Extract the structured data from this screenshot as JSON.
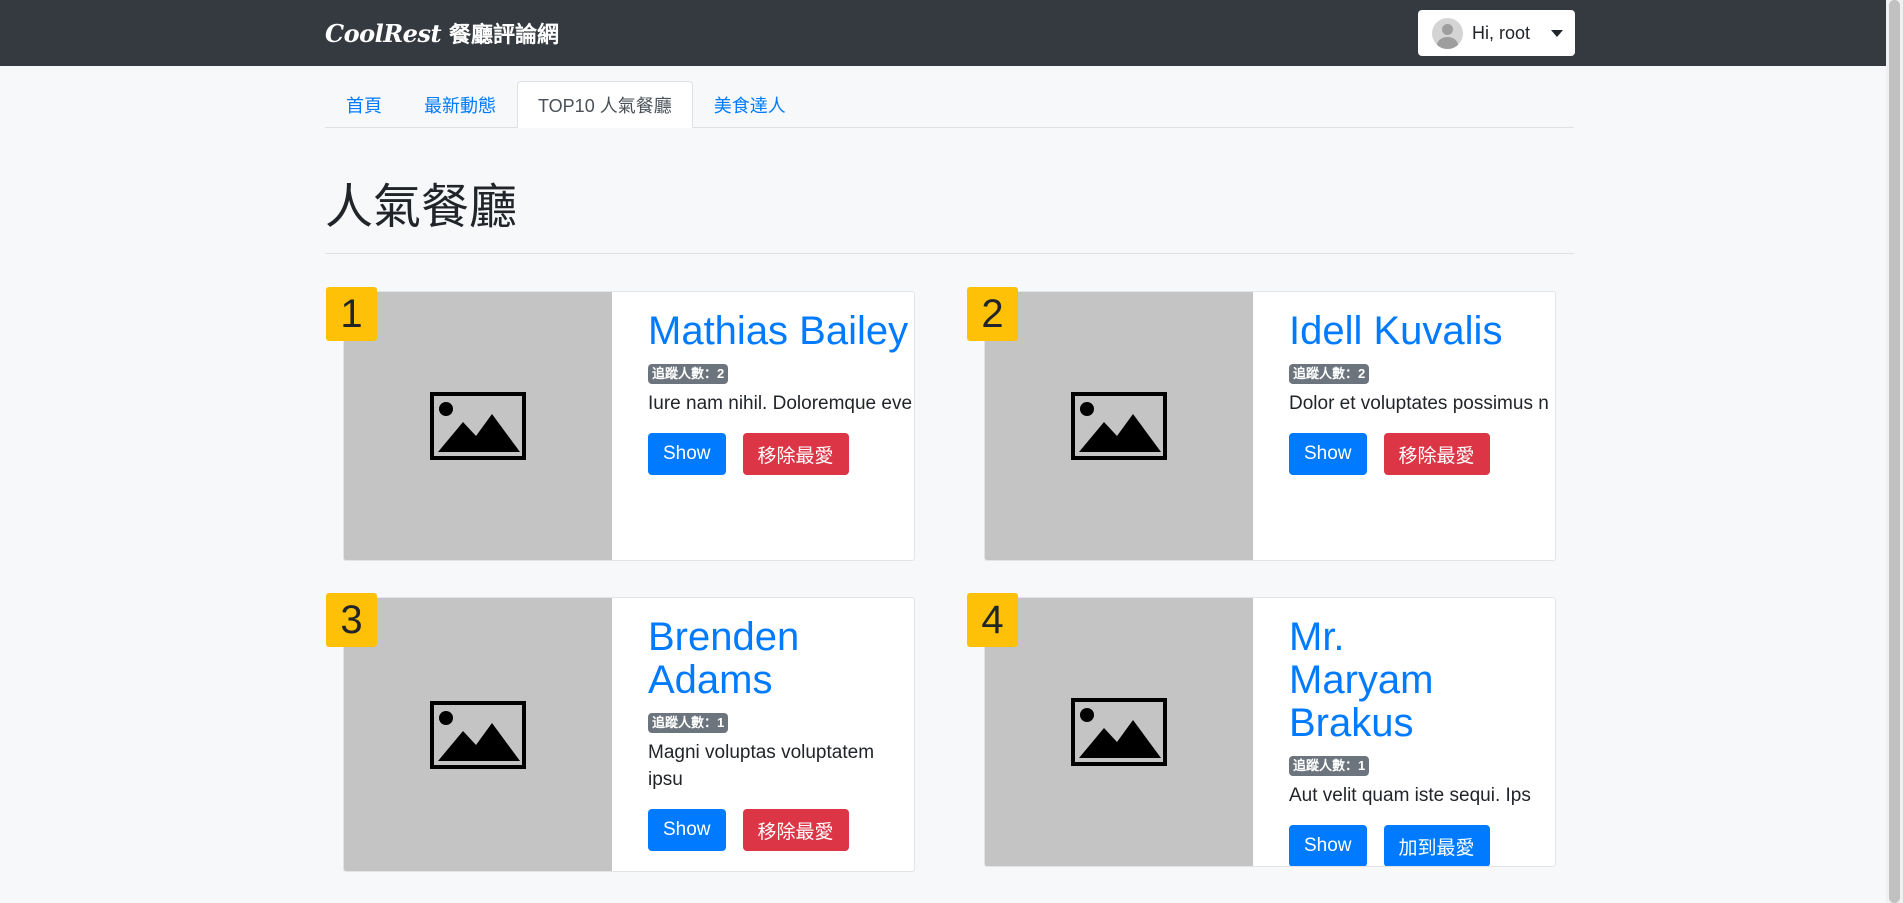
{
  "navbar": {
    "brand_logo": "CoolRest",
    "brand_name": "餐廳評論網",
    "user_label": "Hi, root"
  },
  "tabs": [
    {
      "label": "首頁",
      "active": false
    },
    {
      "label": "最新動態",
      "active": false
    },
    {
      "label": "TOP10 人氣餐廳",
      "active": true
    },
    {
      "label": "美食達人",
      "active": false
    }
  ],
  "page": {
    "title": "人氣餐廳"
  },
  "restaurants": [
    {
      "rank": "1",
      "name": "Mathias Bailey",
      "badge": "追蹤人數：2",
      "description": "Iure nam nihil. Doloremque eve",
      "show_label": "Show",
      "fav_label": "移除最愛",
      "favorited": true
    },
    {
      "rank": "2",
      "name": "Idell Kuvalis",
      "badge": "追蹤人數：2",
      "description": "Dolor et voluptates possimus n",
      "show_label": "Show",
      "fav_label": "移除最愛",
      "favorited": true
    },
    {
      "rank": "3",
      "name": "Brenden Adams",
      "badge": "追蹤人數：1",
      "description": "Magni voluptas voluptatem ipsu",
      "show_label": "Show",
      "fav_label": "移除最愛",
      "favorited": true
    },
    {
      "rank": "4",
      "name": "Mr. Maryam Brakus",
      "badge": "追蹤人數：1",
      "description": "Aut velit quam iste sequi. Ips",
      "show_label": "Show",
      "fav_label": "加到最愛",
      "favorited": false
    }
  ],
  "colors": {
    "navbar_bg": "#343a40",
    "link": "#007bff",
    "danger": "#dc3545",
    "rank_badge": "#ffc107",
    "placeholder_bg": "#c4c4c4"
  },
  "icons": {
    "thumbnail": "image-placeholder-icon",
    "user": "avatar-icon",
    "menu": "caret-down-icon"
  }
}
